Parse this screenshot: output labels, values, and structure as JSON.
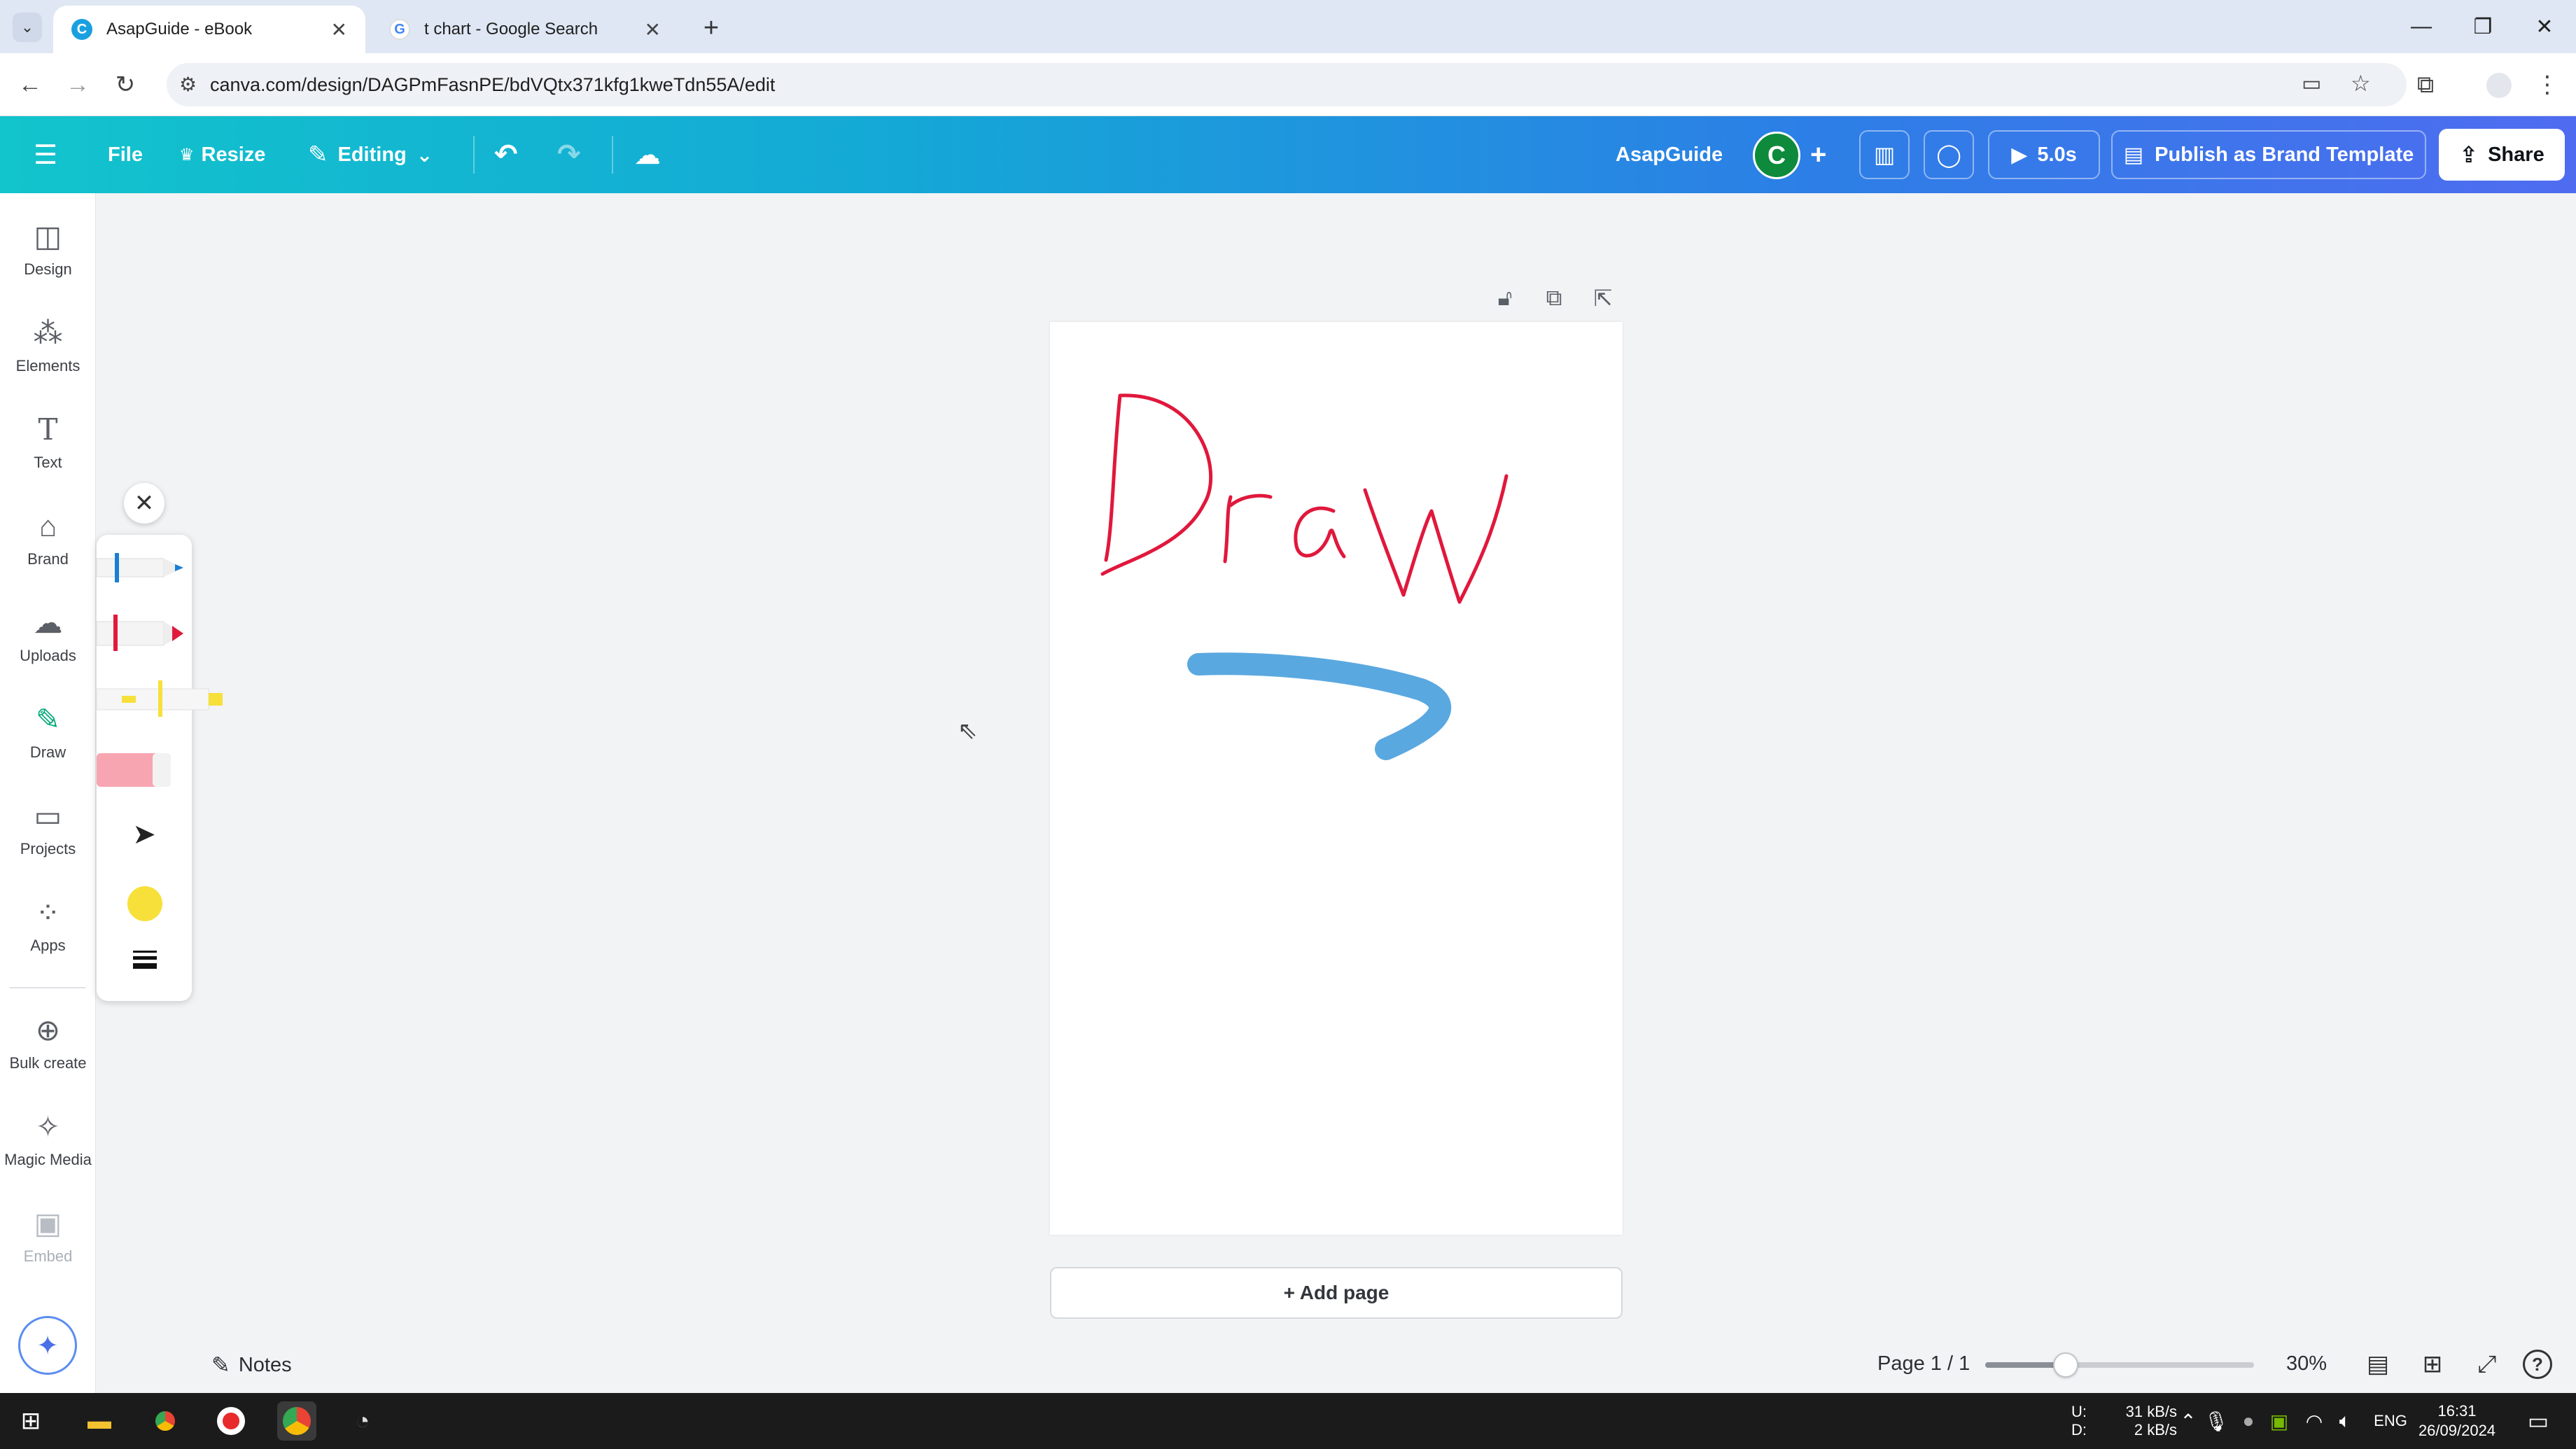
{
  "browser": {
    "tabs": [
      {
        "title": "AsapGuide - eBook",
        "favicon": "canva-icon"
      },
      {
        "title": "t chart - Google Search",
        "favicon": "google-icon"
      }
    ],
    "new_tab_label": "+",
    "url": "canva.com/design/DAGPmFasnPE/bdVQtx371kfg1kweTdn55A/edit"
  },
  "header": {
    "file_label": "File",
    "resize_label": "Resize",
    "editing_label": "Editing",
    "design_title": "AsapGuide",
    "avatar_initial": "C",
    "play_duration": "5.0s",
    "publish_label": "Publish as Brand Template",
    "share_label": "Share"
  },
  "rail": {
    "items": [
      {
        "label": "Design",
        "icon": "design-icon"
      },
      {
        "label": "Elements",
        "icon": "elements-icon"
      },
      {
        "label": "Text",
        "icon": "text-icon"
      },
      {
        "label": "Brand",
        "icon": "brand-icon"
      },
      {
        "label": "Uploads",
        "icon": "uploads-icon"
      },
      {
        "label": "Draw",
        "icon": "draw-icon"
      },
      {
        "label": "Projects",
        "icon": "projects-icon"
      },
      {
        "label": "Apps",
        "icon": "apps-icon"
      },
      {
        "label": "Bulk create",
        "icon": "bulk-create-icon"
      },
      {
        "label": "Magic Media",
        "icon": "magic-media-icon"
      },
      {
        "label": "Embed",
        "icon": "embed-icon"
      }
    ],
    "active": "Draw"
  },
  "draw_panel": {
    "tools": [
      "pen",
      "marker",
      "highlighter",
      "eraser",
      "select"
    ],
    "pen_color": "#1a7fd4",
    "marker_color": "#e01a3c",
    "highlighter_color": "#f7e03a",
    "current_color": "#f7e03a"
  },
  "canvas": {
    "drawn_word_color": "#e0183c",
    "stroke_color": "#5aa8e0",
    "add_page_label": "+ Add page"
  },
  "footer": {
    "notes_label": "Notes",
    "page_indicator": "Page 1 / 1",
    "zoom": "30%",
    "zoom_fraction": 0.3
  },
  "taskbar": {
    "net_up_label": "U:",
    "net_down_label": "D:",
    "net_up": "31 kB/s",
    "net_down": "2 kB/s",
    "lang": "ENG",
    "time": "16:31",
    "date": "26/09/2024"
  }
}
